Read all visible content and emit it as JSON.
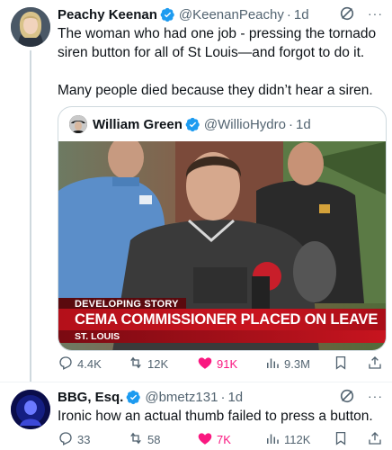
{
  "tweet1": {
    "author_name": "Peachy Keenan",
    "handle": "@KeenanPeachy",
    "time": "1d",
    "text_line1": "The woman who had one job - pressing the tornado",
    "text_line2": "siren button for all of St Louis—and forgot to do it.",
    "text_para2": "Many people died because they didn’t hear a siren.",
    "quote": {
      "author_name": "William Green",
      "handle": "@WillioHydro",
      "time": "1d",
      "chyron_label": "DEVELOPING STORY",
      "chyron_headline": "CEMA COMMISSIONER PLACED ON LEAVE",
      "chyron_location": "ST. LOUIS"
    },
    "stats": {
      "replies": "4.4K",
      "reposts": "12K",
      "likes": "91K",
      "views": "9.3M"
    }
  },
  "tweet2": {
    "author_name": "BBG, Esq.",
    "handle": "@bmetz131",
    "time": "1d",
    "text": "Ironic how an actual thumb failed to press a button.",
    "stats": {
      "replies": "33",
      "reposts": "58",
      "likes": "7K",
      "views": "112K"
    }
  },
  "dot_separator": "·",
  "more_glyph": "···",
  "colors": {
    "verified": "#1d9bf0",
    "like_active": "#f91880",
    "secondary_text": "#536471",
    "chyron_red": "#c8141f"
  },
  "icons": [
    "verified-badge-icon",
    "grok-icon",
    "more-icon",
    "reply-icon",
    "repost-icon",
    "like-icon",
    "views-icon",
    "bookmark-icon",
    "share-icon"
  ]
}
